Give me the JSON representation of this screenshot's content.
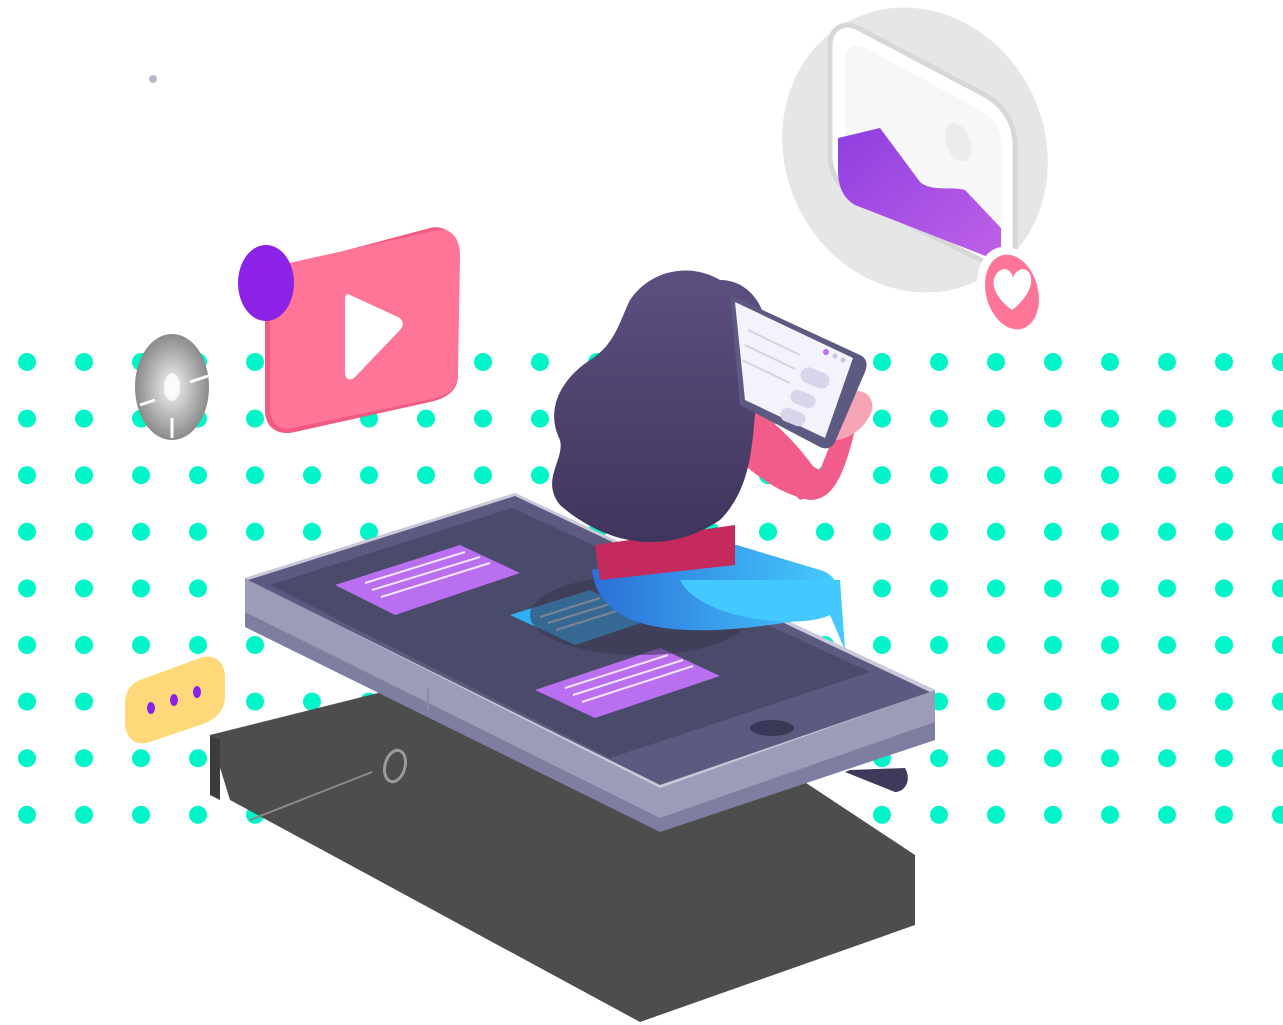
{
  "illustration": {
    "subject": "woman-reading-tablet-on-smartphone",
    "icons": [
      "play-icon",
      "image-icon",
      "heart-icon",
      "chat-bubble-icon",
      "compass-icon"
    ],
    "colors": {
      "dots": "#00f5c8",
      "phone_body": "#5c5a80",
      "phone_screen": "#4a4a6a",
      "phone_edge": "#c9c9da",
      "base_block": "#4d4d4d",
      "video_card": "#ff7598",
      "notification_dot": "#8b22e6",
      "message_card": "#b96ff0",
      "message_card_active": "#2fb0f5",
      "chat_bubble": "#ffd87a",
      "image_frame": "#e6e6e6",
      "image_fill": "#a24fe0",
      "hair": "#4b3f6b",
      "shirt": "#f25c8a",
      "pants": "#3aa0f0"
    }
  }
}
